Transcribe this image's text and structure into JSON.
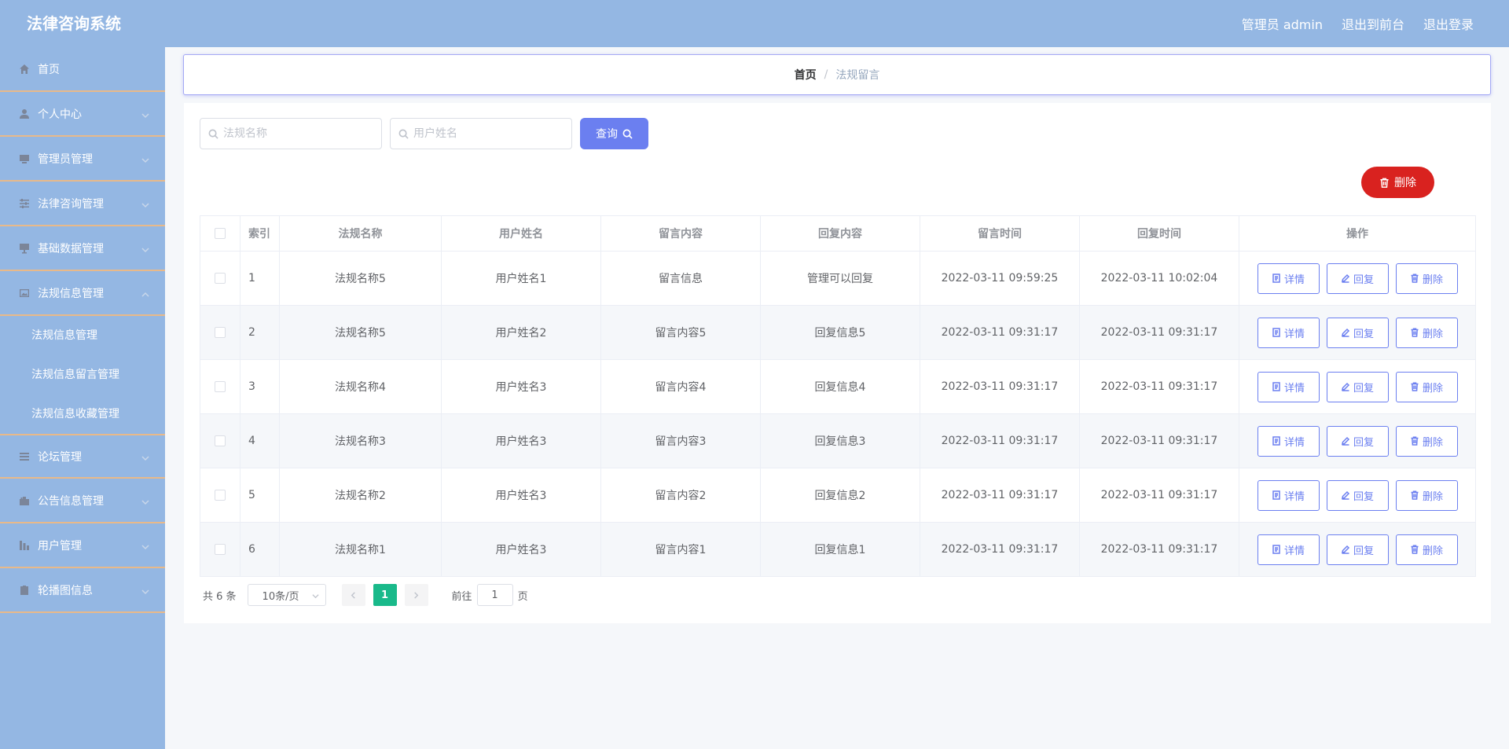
{
  "header": {
    "app_title": "法律咨询系统",
    "admin_label": "管理员 admin",
    "exit_front_label": "退出到前台",
    "logout_label": "退出登录"
  },
  "sidebar": {
    "items": [
      {
        "label": "首页",
        "icon": "home-icon"
      },
      {
        "label": "个人中心",
        "icon": "user-icon"
      },
      {
        "label": "管理员管理",
        "icon": "monitor-icon"
      },
      {
        "label": "法律咨询管理",
        "icon": "sliders-icon"
      },
      {
        "label": "基础数据管理",
        "icon": "monitor-stand-icon"
      },
      {
        "label": "法规信息管理",
        "icon": "picture-icon",
        "expanded": true
      },
      {
        "label": "论坛管理",
        "icon": "list-icon"
      },
      {
        "label": "公告信息管理",
        "icon": "suitcase-icon"
      },
      {
        "label": "用户管理",
        "icon": "bar-chart-icon"
      },
      {
        "label": "轮播图信息",
        "icon": "clipboard-icon"
      }
    ],
    "submenu": [
      "法规信息管理",
      "法规信息留言管理",
      "法规信息收藏管理"
    ]
  },
  "breadcrumb": {
    "home": "首页",
    "separator": "/",
    "current": "法规留言"
  },
  "search": {
    "law_name_placeholder": "法规名称",
    "user_name_placeholder": "用户姓名",
    "query_label": "查询"
  },
  "actions": {
    "delete_label": "删除"
  },
  "table": {
    "headers": [
      "索引",
      "法规名称",
      "用户姓名",
      "留言内容",
      "回复内容",
      "留言时间",
      "回复时间",
      "操作"
    ],
    "op_labels": {
      "detail": "详情",
      "reply": "回复",
      "delete": "删除"
    },
    "rows": [
      {
        "index": "1",
        "law_name": "法规名称5",
        "user_name": "用户姓名1",
        "message": "留言信息",
        "reply": "管理可以回复",
        "message_time": "2022-03-11 09:59:25",
        "reply_time": "2022-03-11 10:02:04"
      },
      {
        "index": "2",
        "law_name": "法规名称5",
        "user_name": "用户姓名2",
        "message": "留言内容5",
        "reply": "回复信息5",
        "message_time": "2022-03-11 09:31:17",
        "reply_time": "2022-03-11 09:31:17"
      },
      {
        "index": "3",
        "law_name": "法规名称4",
        "user_name": "用户姓名3",
        "message": "留言内容4",
        "reply": "回复信息4",
        "message_time": "2022-03-11 09:31:17",
        "reply_time": "2022-03-11 09:31:17"
      },
      {
        "index": "4",
        "law_name": "法规名称3",
        "user_name": "用户姓名3",
        "message": "留言内容3",
        "reply": "回复信息3",
        "message_time": "2022-03-11 09:31:17",
        "reply_time": "2022-03-11 09:31:17"
      },
      {
        "index": "5",
        "law_name": "法规名称2",
        "user_name": "用户姓名3",
        "message": "留言内容2",
        "reply": "回复信息2",
        "message_time": "2022-03-11 09:31:17",
        "reply_time": "2022-03-11 09:31:17"
      },
      {
        "index": "6",
        "law_name": "法规名称1",
        "user_name": "用户姓名3",
        "message": "留言内容1",
        "reply": "回复信息1",
        "message_time": "2022-03-11 09:31:17",
        "reply_time": "2022-03-11 09:31:17"
      }
    ]
  },
  "pagination": {
    "total_text": "共 6 条",
    "page_size": "10条/页",
    "current_page": "1",
    "goto_prefix": "前往",
    "goto_value": "1",
    "goto_suffix": "页"
  },
  "colors": {
    "sidebar_bg": "#94b7e3",
    "primary": "#6b7ff0",
    "danger": "#d9221f",
    "active_page": "#19b98a"
  }
}
